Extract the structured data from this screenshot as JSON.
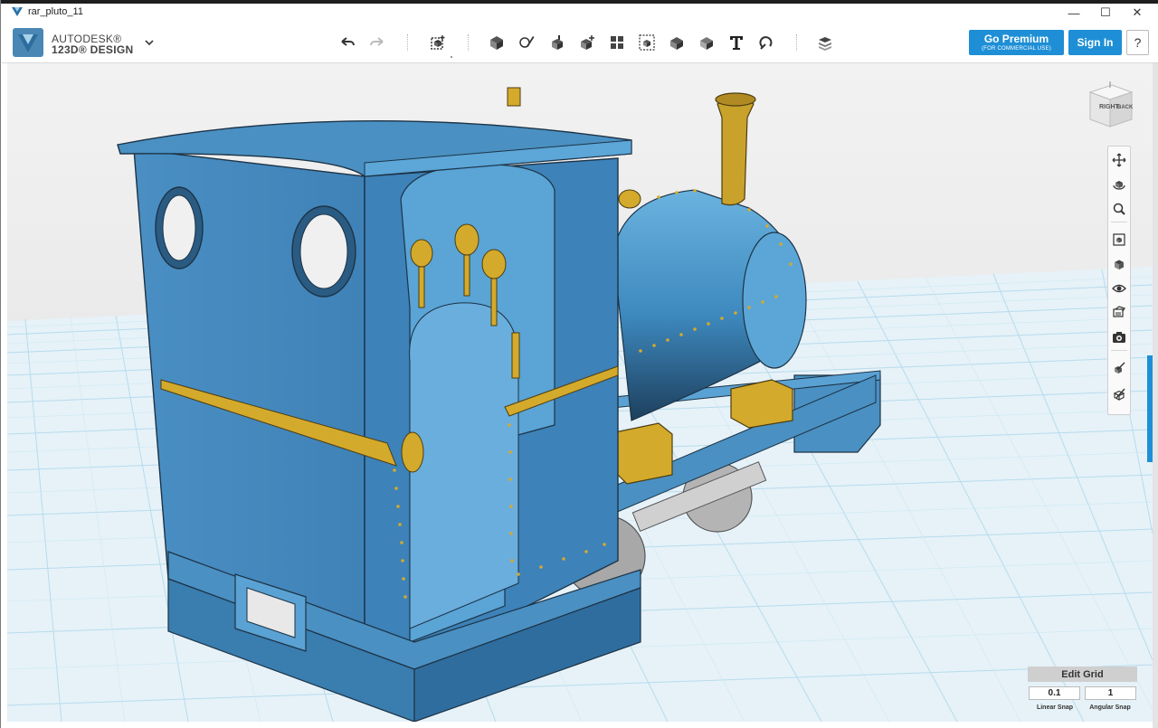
{
  "window": {
    "title": "rar_pluto_11",
    "min": "—",
    "max": "☐",
    "close": "✕"
  },
  "brand": {
    "line1": "AUTODESK®",
    "line2": "123D® DESIGN"
  },
  "toolbar": {
    "tools": [
      "undo-icon",
      "redo-icon",
      "transform-icon",
      "primitives-icon",
      "sketch-icon",
      "construct-icon",
      "modify-icon",
      "pattern-icon",
      "grouping-icon",
      "combine-icon",
      "measure-icon",
      "text-icon",
      "snap-icon",
      "material-icon"
    ]
  },
  "account": {
    "premium_label": "Go Premium",
    "premium_sub": "(FOR COMMERCIAL USE)",
    "signin_label": "Sign In",
    "help_label": "?"
  },
  "viewcube": {
    "face_right": "RIGHT",
    "face_back": "BACK"
  },
  "nav": [
    "pan-icon",
    "orbit-icon",
    "zoom-icon",
    "fit-icon",
    "views-icon",
    "visibility-icon",
    "materials-icon",
    "camera-icon",
    "hide-icon",
    "outline-icon"
  ],
  "grid": {
    "title": "Edit Grid",
    "linear_value": "0.1",
    "angular_value": "1",
    "linear_label": "Linear Snap",
    "angular_label": "Angular Snap"
  },
  "colors": {
    "accent": "#1e8fd6",
    "model_body": "#4a90c2",
    "model_brass": "#d4aa2c",
    "grid_line": "#aed4e8"
  }
}
